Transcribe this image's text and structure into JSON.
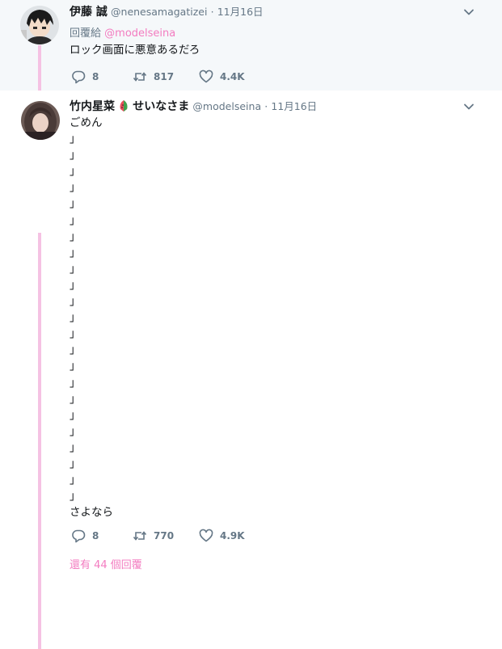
{
  "tweets": [
    {
      "display_name": "伊藤 誠",
      "username": "@nenesamagatizei",
      "separator": "·",
      "date": "11月16日",
      "reply_label": "回覆給",
      "reply_handle": "@modelseina",
      "text": "ロック画面に悪意あるだろ",
      "replies": "8",
      "retweets": "817",
      "likes": "4.4K"
    },
    {
      "display_name": "竹内星菜",
      "display_name_suffix": "せいなさま",
      "username": "@modelseina",
      "separator": "·",
      "date": "11月16日",
      "lines": [
        "ごめん",
        "」",
        "」",
        "」",
        "」",
        "」",
        "」",
        "」",
        "」",
        "」",
        "」",
        "」",
        "」",
        "」",
        "」",
        "」",
        "」",
        "」",
        "」",
        "」",
        "」",
        "」",
        "」",
        "」",
        "さよなら"
      ],
      "replies": "8",
      "retweets": "770",
      "likes": "4.9K"
    }
  ],
  "more_replies": "還有 44 個回覆",
  "colors": {
    "accent": "#f37cc0",
    "thread": "#f5c2e3",
    "muted": "#657786"
  },
  "icons": {
    "caret": "chevron-down-icon",
    "reply": "reply-icon",
    "retweet": "retweet-icon",
    "like": "heart-icon",
    "emoji": "watermelon-icon"
  }
}
